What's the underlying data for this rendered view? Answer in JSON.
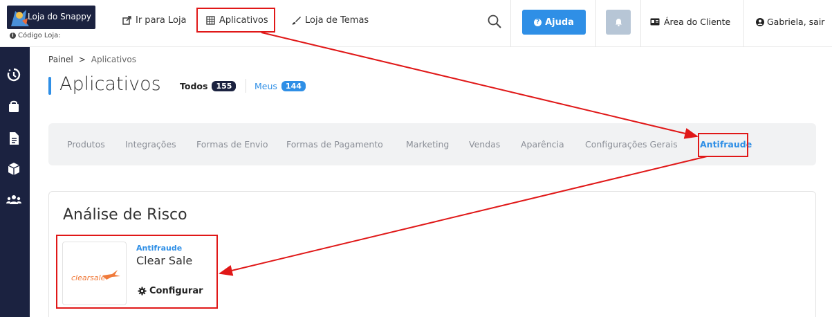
{
  "header": {
    "logo_text": "Loja do Snappy",
    "store_code": "Código Loja:",
    "nav": {
      "go_store": "Ir para Loja",
      "apps": "Aplicativos",
      "themes": "Loja de Temas"
    },
    "help": "Ajuda",
    "client_area": "Área do Cliente",
    "user": "Gabriela, sair"
  },
  "breadcrumb": {
    "root": "Painel",
    "sep": ">",
    "current": "Aplicativos"
  },
  "page": {
    "title": "Aplicativos",
    "filters": {
      "all_label": "Todos",
      "all_count": "155",
      "mine_label": "Meus",
      "mine_count": "144"
    }
  },
  "categories": {
    "products": "Produtos",
    "integrations": "Integrações",
    "shipping": "Formas de Envio",
    "payment": "Formas de Pagamento",
    "marketing": "Marketing",
    "sales": "Vendas",
    "appearance": "Aparência",
    "general": "Configurações Gerais",
    "antifraud": "Antifraude"
  },
  "section": {
    "title": "Análise de Risco",
    "app": {
      "logo_text": "clearsale",
      "category": "Antifraude",
      "name": "Clear Sale",
      "action": "Configurar"
    }
  },
  "colors": {
    "accent": "#2f8fe6",
    "sidebar": "#1b2240",
    "annotation": "#e01818",
    "clearsale": "#f07a3a"
  }
}
